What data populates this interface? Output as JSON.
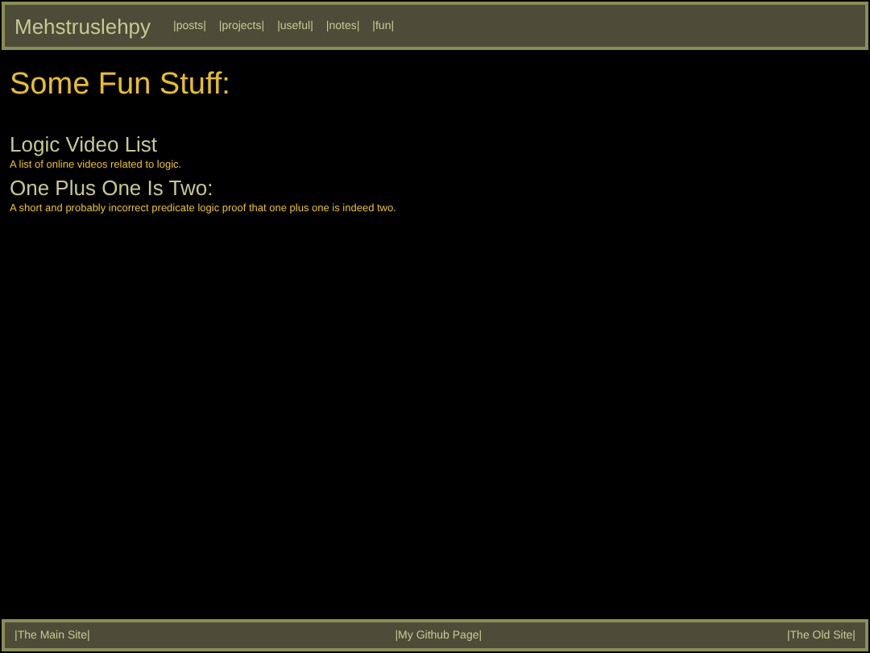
{
  "header": {
    "site_title": "Mehstruslehpy",
    "nav": [
      "|posts|",
      "|projects|",
      "|useful|",
      "|notes|",
      "|fun|"
    ]
  },
  "page": {
    "title": "Some Fun Stuff:",
    "entries": [
      {
        "title": "Logic Video List",
        "description": "A list of online videos related to logic."
      },
      {
        "title": "One Plus One Is Two:",
        "description": "A short and probably incorrect predicate logic proof that one plus one is indeed two."
      }
    ]
  },
  "footer": {
    "links": [
      "|The Main Site|",
      "|My Github Page|",
      "|The Old Site|"
    ]
  }
}
